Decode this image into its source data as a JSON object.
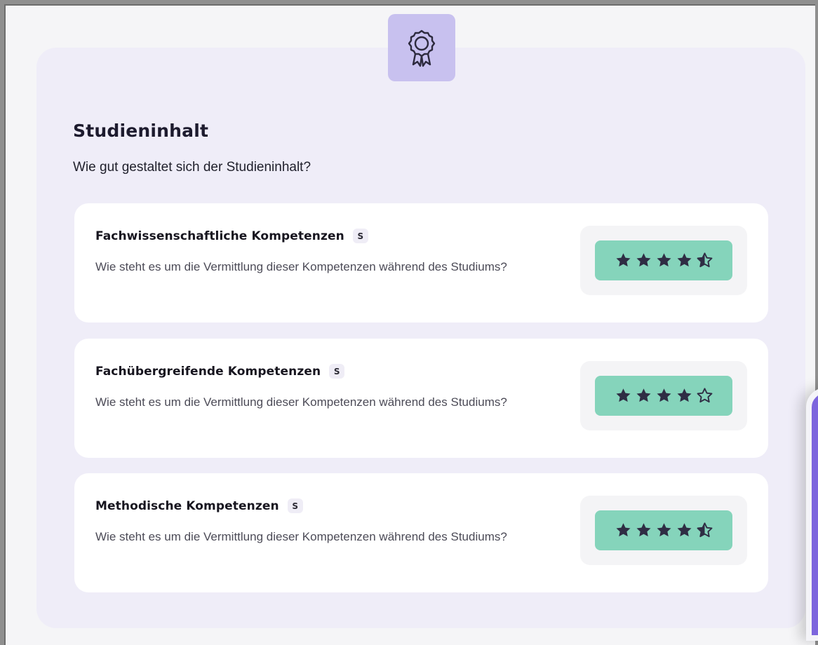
{
  "section": {
    "title": "Studieninhalt",
    "subtitle": "Wie gut gestaltet sich der Studieninhalt?",
    "icon": "award-ribbon-icon"
  },
  "colors": {
    "page_background": "#f5f5f7",
    "section_background": "#efedf8",
    "icon_badge_background": "#c8c1ef",
    "rating_pill": "#85d4bb",
    "star_color": "#2f2d44",
    "side_panel": "#7d66dd"
  },
  "categories": [
    {
      "title": "Fachwissenschaftliche Kompetenzen",
      "badge": "S",
      "description": "Wie steht es um die Vermittlung dieser Kompetenzen während des Studiums?",
      "rating": 4.5,
      "stars": [
        "full",
        "full",
        "full",
        "full",
        "half"
      ]
    },
    {
      "title": "Fachübergreifende Kompetenzen",
      "badge": "S",
      "description": "Wie steht es um die Vermittlung dieser Kompetenzen während des Studiums?",
      "rating": 4,
      "stars": [
        "full",
        "full",
        "full",
        "full",
        "empty"
      ]
    },
    {
      "title": "Methodische Kompetenzen",
      "badge": "S",
      "description": "Wie steht es um die Vermittlung dieser Kompetenzen während des Studiums?",
      "rating": 4.5,
      "stars": [
        "full",
        "full",
        "full",
        "full",
        "half"
      ]
    }
  ]
}
